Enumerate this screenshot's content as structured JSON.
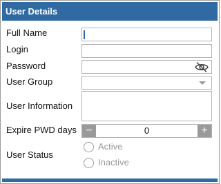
{
  "panel": {
    "title": "User Details"
  },
  "fields": {
    "full_name": {
      "label": "Full Name",
      "value": ""
    },
    "login": {
      "label": "Login",
      "value": ""
    },
    "password": {
      "label": "Password",
      "value": ""
    },
    "user_group": {
      "label": "User Group",
      "value": ""
    },
    "user_information": {
      "label": "User Information",
      "value": ""
    },
    "expire_pwd_days": {
      "label": "Expire PWD days",
      "value": "0",
      "minus": "−",
      "plus": "+"
    },
    "user_status": {
      "label": "User Status",
      "options": [
        "Active",
        "Inactive"
      ],
      "selected": null
    }
  },
  "icons": {
    "password_toggle": "eye-slash-icon",
    "dropdown": "chevron-down-icon"
  },
  "colors": {
    "accent": "#2f6aa3",
    "border": "#b3b3b3",
    "muted": "#9a9a9a"
  }
}
